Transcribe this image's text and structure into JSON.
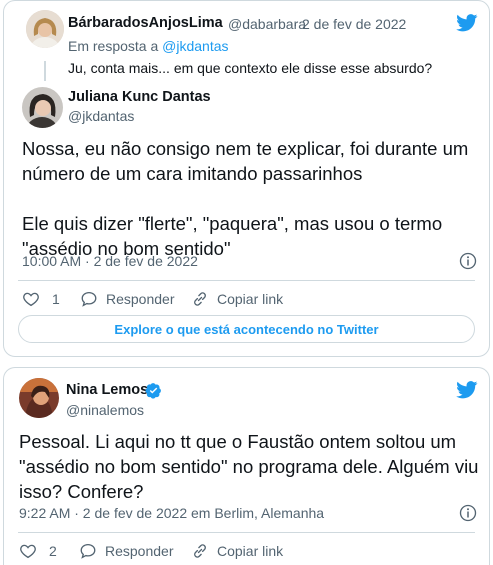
{
  "colors": {
    "accent": "#1d9bf0",
    "muted": "#536471",
    "text": "#0f1419",
    "border": "#cfd9de",
    "verified": "#1d9bf0"
  },
  "tweet1": {
    "parent": {
      "name": "BárbaradosAnjosLima",
      "handle": "@dabarbara",
      "sep": "·",
      "date": "2 de fev de 2022",
      "reply_prefix": "Em resposta a ",
      "reply_to": "@jkdantas",
      "text": "Ju, conta mais... em que contexto ele disse esse absurdo?"
    },
    "author": {
      "name": "Juliana Kunc Dantas",
      "handle": "@jkdantas"
    },
    "body": [
      "Nossa, eu não consigo nem te explicar, foi durante um",
      "número de um cara imitando passarinhos",
      "",
      "Ele quis dizer \"flerte\", \"paquera\", mas usou o termo",
      "\"assédio no bom sentido\""
    ],
    "timestamp": "10:00 AM · 2 de fev de 2022",
    "likes": "1",
    "reply_label": "Responder",
    "copy_label": "Copiar link",
    "explore_label": "Explore o que está acontecendo no Twitter"
  },
  "tweet2": {
    "author": {
      "name": "Nina Lemos",
      "handle": "@ninalemos"
    },
    "body": [
      "Pessoal. Li aqui no tt que o Faustão ontem soltou um",
      "\"assédio no bom sentido\" no programa dele. Alguém viu",
      "isso? Confere?"
    ],
    "timestamp": "9:22 AM · 2 de fev de 2022 em Berlim, Alemanha",
    "likes": "2",
    "reply_label": "Responder",
    "copy_label": "Copiar link"
  }
}
